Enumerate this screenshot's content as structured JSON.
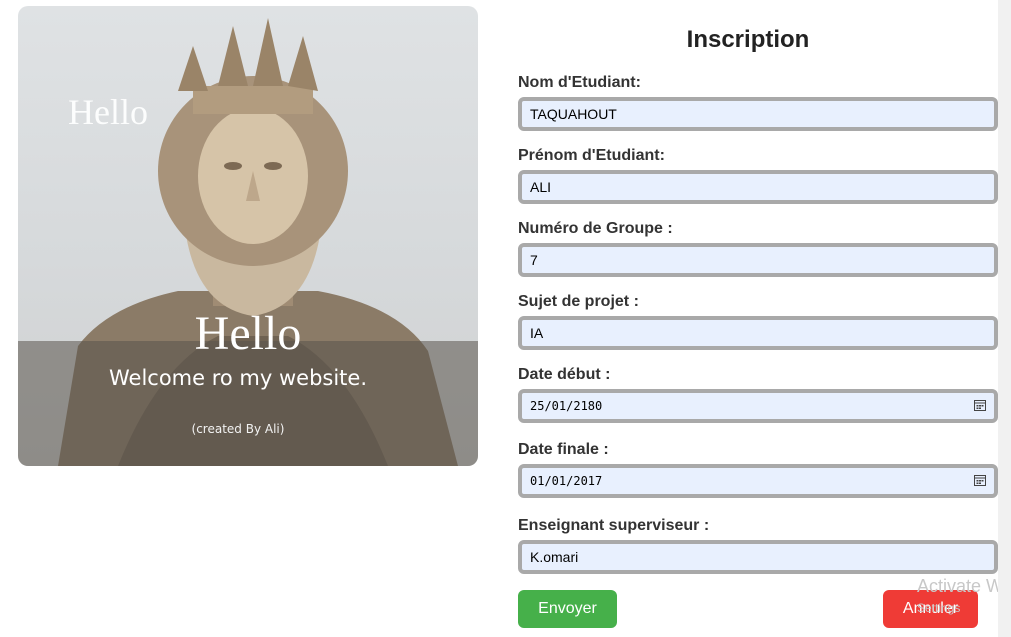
{
  "hero": {
    "hello_top": "Hello",
    "hello_main": "Hello",
    "welcome": "Welcome ro my website.",
    "created": "(created By Ali)"
  },
  "form": {
    "title": "Inscription",
    "fields": [
      {
        "label": "Nom d'Etudiant:",
        "value": "TAQUAHOUT"
      },
      {
        "label": "Prénom d'Etudiant:",
        "value": "ALI"
      },
      {
        "label": "Numéro de Groupe :",
        "value": "7"
      },
      {
        "label": "Sujet de projet :",
        "value": "IA"
      },
      {
        "label": "Date début :",
        "value": "25/01/2180"
      },
      {
        "label": "Date finale :",
        "value": "01/01/2017"
      },
      {
        "label": "Enseignant superviseur :",
        "value": "K.omari"
      }
    ],
    "submit_label": "Envoyer",
    "cancel_label": "Annuler"
  },
  "watermark": {
    "title": "Activate W",
    "subtitle": "Settings"
  },
  "colors": {
    "submit": "#46b04a",
    "cancel": "#ef3b36",
    "input_bg": "#e8f0fe",
    "input_border": "#a9a9a9"
  },
  "icons": [
    "calendar-icon"
  ]
}
